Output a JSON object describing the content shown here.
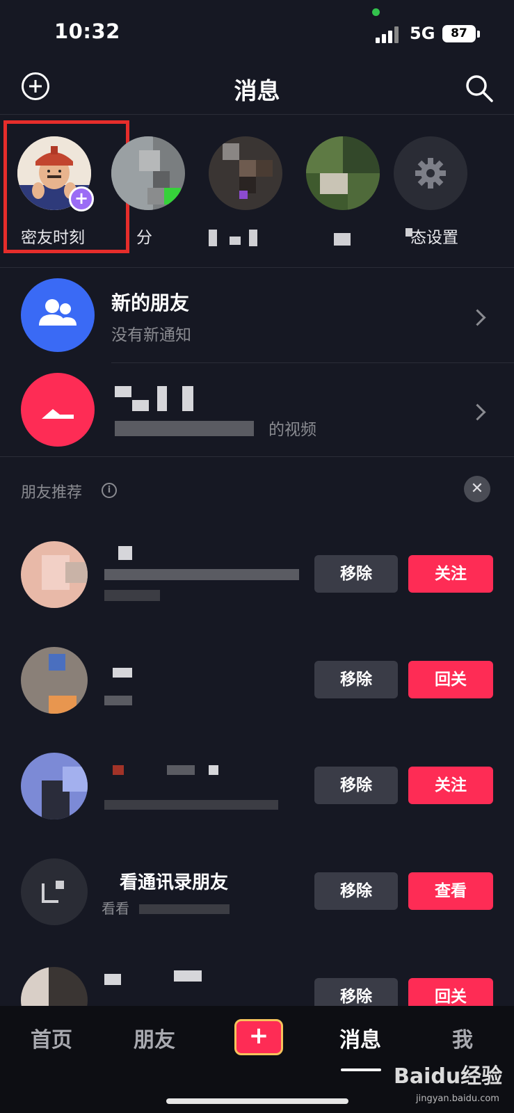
{
  "status_bar": {
    "time": "10:32",
    "network": "5G",
    "battery": "87"
  },
  "header": {
    "title": "消息"
  },
  "stories": {
    "first_label": "密友时刻",
    "settings_label_fragment": "态设置",
    "second_label_fragment": "分"
  },
  "notifications": [
    {
      "title": "新的朋友",
      "subtitle": "没有新通知"
    },
    {
      "subtitle_fragment": "的视频"
    }
  ],
  "recommendations": {
    "title": "朋友推荐",
    "info_icon": "i",
    "close_icon": "✕",
    "items": [
      {
        "remove_label": "移除",
        "action_label": "关注"
      },
      {
        "remove_label": "移除",
        "action_label": "回关"
      },
      {
        "remove_label": "移除",
        "action_label": "关注"
      },
      {
        "name": "看通讯录朋友",
        "sub_fragment": "看看",
        "remove_label": "移除",
        "action_label": "查看"
      },
      {
        "remove_label": "移除",
        "action_label": "回关"
      }
    ]
  },
  "nav": {
    "items": [
      "首页",
      "朋友",
      "消息",
      "我"
    ],
    "create_label": "+",
    "active": "消息"
  },
  "watermark": {
    "brand": "Baidu经验",
    "url": "jingyan.baidu.com"
  },
  "colors": {
    "background": "#161823",
    "accent_red": "#fe2c55",
    "highlight_box": "#e62d2b",
    "story_badge": "#9b6cf5"
  }
}
